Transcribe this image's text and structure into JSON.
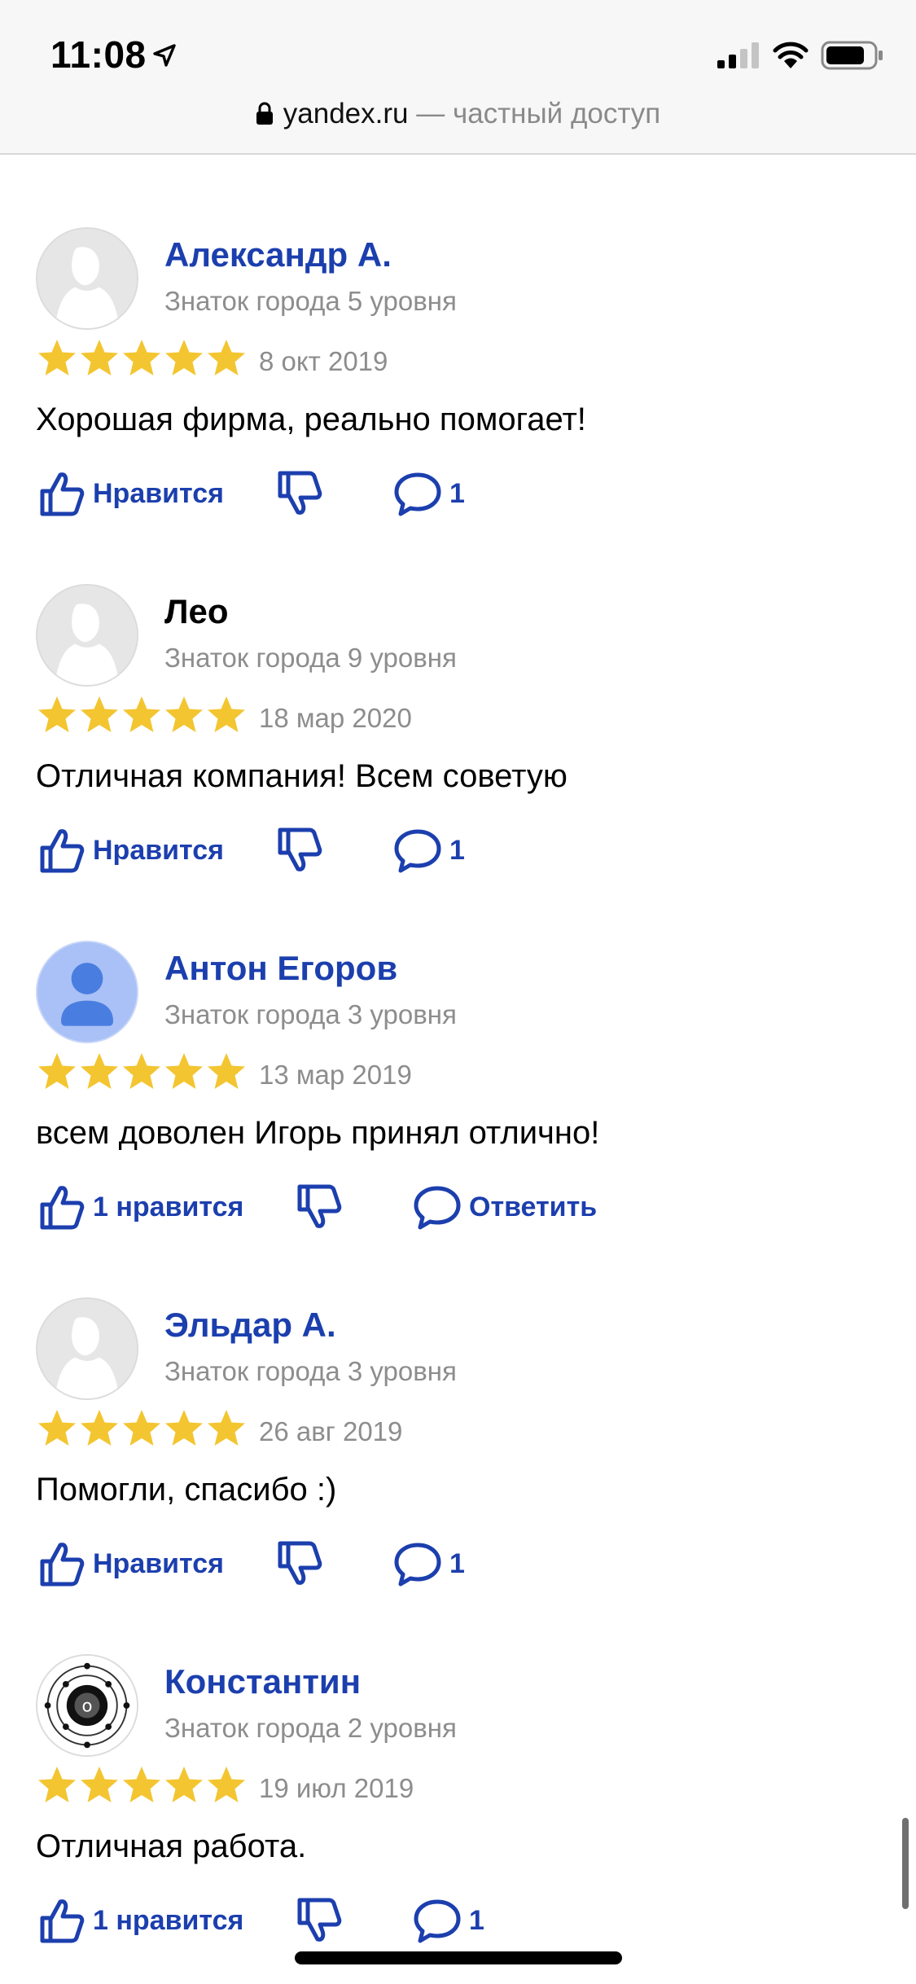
{
  "status_bar": {
    "time": "11:08"
  },
  "address_bar": {
    "domain": "yandex.ru",
    "separator": " — ",
    "mode": "частный доступ"
  },
  "colors": {
    "accent": "#1c3fae",
    "star": "#f3c530",
    "muted": "#8d8d8d"
  },
  "rating_max": 5,
  "reviews": [
    {
      "name": "Александр А.",
      "name_is_link": true,
      "avatar": "default-avatar",
      "level": "Знаток города 5 уровня",
      "rating": 5,
      "date": "8 окт 2019",
      "text": "Хорошая фирма, реально помогает!",
      "like_label": "Нравится",
      "reply_label": "1"
    },
    {
      "name": "Лео",
      "name_is_link": false,
      "avatar": "default-avatar",
      "level": "Знаток города 9 уровня",
      "rating": 5,
      "date": "18 мар 2020",
      "text": "Отличная компания! Всем советую",
      "like_label": "Нравится",
      "reply_label": "1"
    },
    {
      "name": "Антон Егоров",
      "name_is_link": true,
      "avatar": "person-avatar",
      "level": "Знаток города 3 уровня",
      "rating": 5,
      "date": "13 мар 2019",
      "text": "всем доволен Игорь принял отлично!",
      "like_label": "1 нравится",
      "reply_label": "Ответить"
    },
    {
      "name": "Эльдар А.",
      "name_is_link": true,
      "avatar": "default-avatar",
      "level": "Знаток города 3 уровня",
      "rating": 5,
      "date": "26 авг 2019",
      "text": "Помогли, спасибо :)",
      "like_label": "Нравится",
      "reply_label": "1"
    },
    {
      "name": "Константин",
      "name_is_link": true,
      "avatar": "atom-avatar",
      "level": "Знаток города 2 уровня",
      "rating": 5,
      "date": "19 июл 2019",
      "text": "Отличная работа.",
      "like_label": "1 нравится",
      "reply_label": "1"
    }
  ]
}
